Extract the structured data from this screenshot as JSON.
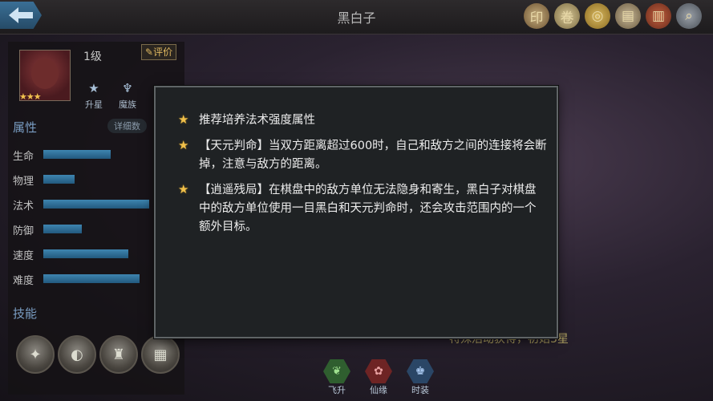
{
  "header": {
    "title": "黑白子",
    "icons": [
      "seal-icon",
      "scroll-icon",
      "coin-icon",
      "notice-icon",
      "book-icon",
      "magnifier-icon"
    ]
  },
  "hero": {
    "level": "1级",
    "rate_label": "评价",
    "stars": 3,
    "star_text": "★★★",
    "buttons": [
      {
        "label": "升星",
        "icon": "star-up-icon"
      },
      {
        "label": "魔族",
        "icon": "demon-race-icon"
      }
    ]
  },
  "attributes": {
    "section_title": "属性",
    "detail_label": "详细数",
    "items": [
      {
        "label": "生命",
        "value": 0.6
      },
      {
        "label": "物理",
        "value": 0.28
      },
      {
        "label": "法术",
        "value": 0.94
      },
      {
        "label": "防御",
        "value": 0.34
      },
      {
        "label": "速度",
        "value": 0.76
      },
      {
        "label": "难度",
        "value": 0.86
      }
    ]
  },
  "skills": {
    "section_title": "技能",
    "icons": [
      "skill-1-icon",
      "skill-2-icon",
      "skill-3-icon",
      "skill-4-icon"
    ]
  },
  "background_note": "特殊活动获得，初始3星",
  "bottom_tabs": [
    {
      "label": "飞升",
      "icon": "leaf-icon",
      "color": "#3a7a3a"
    },
    {
      "label": "仙缘",
      "icon": "fate-icon",
      "color": "#8a2a2a"
    },
    {
      "label": "时装",
      "icon": "costume-icon",
      "color": "#2e4a6e"
    }
  ],
  "tooltip": {
    "items": [
      "推荐培养法术强度属性",
      "【天元判命】当双方距离超过600时，自己和敌方之间的连接将会断掉，注意与敌方的距离。",
      "【逍遥残局】在棋盘中的敌方单位无法隐身和寄生，黑白子对棋盘中的敌方单位使用一目黑白和天元判命时，还会攻击范围内的一个额外目标。"
    ]
  }
}
